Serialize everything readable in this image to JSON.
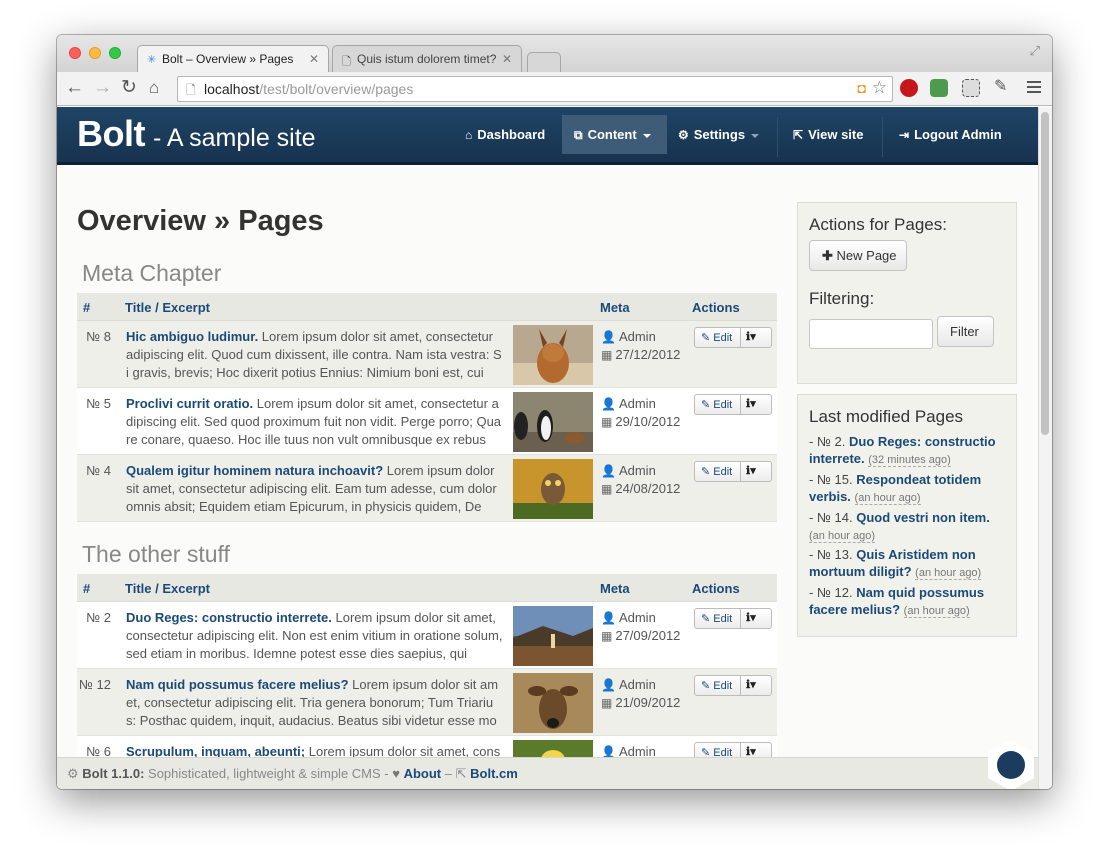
{
  "browser": {
    "tabs": [
      {
        "title": "Bolt – Overview » Pages",
        "icon": "bolt-favicon",
        "active": true
      },
      {
        "title": "Quis istum dolorem timet?",
        "icon": "document-icon",
        "active": false
      }
    ],
    "url_host": "localhost",
    "url_path": "/test/bolt/overview/pages"
  },
  "header": {
    "brand": "Bolt",
    "tagline": "- A sample site",
    "menu": [
      {
        "label": "Dashboard",
        "icon": "home-icon"
      },
      {
        "label": "Content",
        "icon": "sitemap-icon"
      },
      {
        "label": "Settings",
        "icon": "cogs-icon"
      },
      {
        "label": "View site",
        "icon": "external-link-icon"
      },
      {
        "label": "Logout Admin",
        "icon": "sign-out-icon"
      }
    ]
  },
  "page": {
    "title_bold": "Overview",
    "title_rest": " » Pages"
  },
  "table_headers": {
    "num": "#",
    "title": "Title / Excerpt",
    "meta": "Meta",
    "actions": "Actions"
  },
  "groups": [
    {
      "name": "Meta Chapter",
      "rows": [
        {
          "num": "№ 8",
          "title": "Hic ambiguo ludimur.",
          "excerpt": " Lorem ipsum dolor sit amet, consectetur adipiscing elit. Quod cum dixissent, ille contra. Nam ista vestra: Si gravis, brevis; Hoc dixerit potius Ennius: Nimium boni est, cui",
          "author": "Admin",
          "date": "27/12/2012",
          "edit": "Edit"
        },
        {
          "num": "№ 5",
          "title": "Proclivi currit oratio.",
          "excerpt": " Lorem ipsum dolor sit amet, consectetur adipiscing elit. Sed quod proximum fuit non vidit. Perge porro; Quare conare, quaeso. Hoc ille tuus non vult omnibusque ex rebus",
          "author": "Admin",
          "date": "29/10/2012",
          "edit": "Edit"
        },
        {
          "num": "№ 4",
          "title": "Qualem igitur hominem natura inchoavit?",
          "excerpt": " Lorem ipsum dolor sit amet, consectetur adipiscing elit. Eam tum adesse, cum dolor omnis absit; Equidem etiam Epicurum, in physicis quidem, De",
          "author": "Admin",
          "date": "24/08/2012",
          "edit": "Edit"
        }
      ]
    },
    {
      "name": "The other stuff",
      "rows": [
        {
          "num": "№ 2",
          "title": "Duo Reges: constructio interrete.",
          "excerpt": " Lorem ipsum dolor sit amet, consectetur adipiscing elit. Non est enim vitium in oratione solum, sed etiam in moribus. Idemne potest esse dies saepius, qui",
          "author": "Admin",
          "date": "27/09/2012",
          "edit": "Edit"
        },
        {
          "num": "№ 12",
          "title": "Nam quid possumus facere melius?",
          "excerpt": " Lorem ipsum dolor sit amet, consectetur adipiscing elit. Tria genera bonorum; Tum Triarius: Posthac quidem, inquit, audacius. Beatus sibi videtur esse mo",
          "author": "Admin",
          "date": "21/09/2012",
          "edit": "Edit"
        },
        {
          "num": "№ 6",
          "title": "Scrupulum, inquam, abeunti;",
          "excerpt": " Lorem ipsum dolor sit amet, cons",
          "author": "Admin",
          "date": "",
          "edit": "Edit"
        }
      ]
    }
  ],
  "sidebar": {
    "actions_title": "Actions for Pages:",
    "new_page": "New Page",
    "filtering_title": "Filtering:",
    "filter_button": "Filter",
    "filter_value": "",
    "last_modified_title": "Last modified Pages",
    "last_modified": [
      {
        "num": "№ 2.",
        "title": "Duo Reges: constructio interrete.",
        "ago": "(32 minutes ago)"
      },
      {
        "num": "№ 15.",
        "title": "Respondeat totidem verbis.",
        "ago": "(an hour ago)"
      },
      {
        "num": "№ 14.",
        "title": "Quod vestri non item.",
        "ago": "(an hour ago)"
      },
      {
        "num": "№ 13.",
        "title": "Quis Aristidem non mortuum diligit?",
        "ago": "(an hour ago)"
      },
      {
        "num": "№ 12.",
        "title": "Nam quid possumus facere melius?",
        "ago": "(an hour ago)"
      }
    ]
  },
  "footer": {
    "version": "Bolt 1.1.0:",
    "tagline": " Sophisticated, lightweight & simple CMS - ",
    "about": "About",
    "sep": " – ",
    "site": "Bolt.cm"
  },
  "colors": {
    "header": "#1f4466",
    "link": "#1b4a78",
    "panel": "#f2f2ed"
  }
}
